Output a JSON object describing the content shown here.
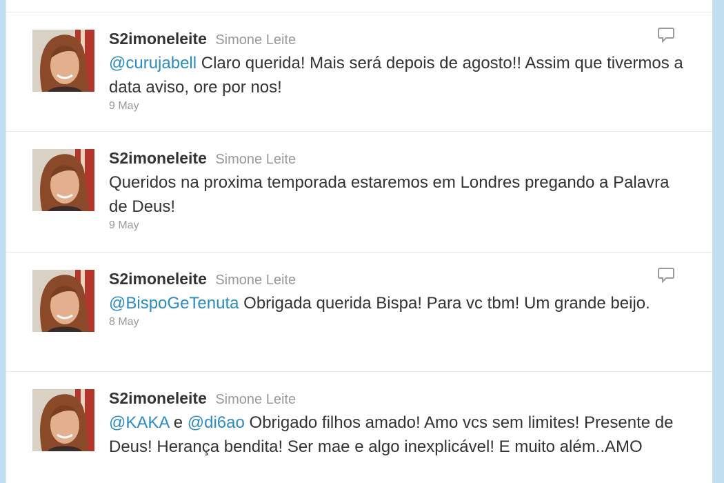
{
  "tweets": [
    {
      "screen_name": "S2imoneleite",
      "full_name": "Simone Leite",
      "time": "9 May",
      "has_reply_icon": true,
      "segments": [
        {
          "text": "@curujabell",
          "mention": true
        },
        {
          "text": " Claro querida! Mais será depois de agosto!! Assim que tivermos a data aviso, ore por nos!",
          "mention": false
        }
      ]
    },
    {
      "screen_name": "S2imoneleite",
      "full_name": "Simone Leite",
      "time": "9 May",
      "has_reply_icon": false,
      "segments": [
        {
          "text": "Queridos na proxima temporada estaremos em Londres pregando a Palavra de Deus!",
          "mention": false
        }
      ]
    },
    {
      "screen_name": "S2imoneleite",
      "full_name": "Simone Leite",
      "time": "8 May",
      "has_reply_icon": true,
      "segments": [
        {
          "text": "@BispoGeTenuta",
          "mention": true
        },
        {
          "text": " Obrigada querida Bispa! Para vc tbm! Um grande beijo.",
          "mention": false
        }
      ]
    },
    {
      "screen_name": "S2imoneleite",
      "full_name": "Simone Leite",
      "time": "",
      "has_reply_icon": false,
      "segments": [
        {
          "text": "@KAKA",
          "mention": true
        },
        {
          "text": " e ",
          "mention": false
        },
        {
          "text": "@di6ao",
          "mention": true
        },
        {
          "text": " Obrigado filhos amado! Amo vcs sem limites! Presente de Deus! Herança bendita! Ser mae e algo inexplicável! E muito além..AMO",
          "mention": false
        }
      ]
    }
  ],
  "colors": {
    "mention": "#2a8cc6",
    "screen_name": "#333333",
    "full_name": "#999999",
    "background": "#c0deed"
  },
  "icons": {
    "reply": "speech-bubble-reply-icon",
    "avatar": "profile-photo"
  }
}
